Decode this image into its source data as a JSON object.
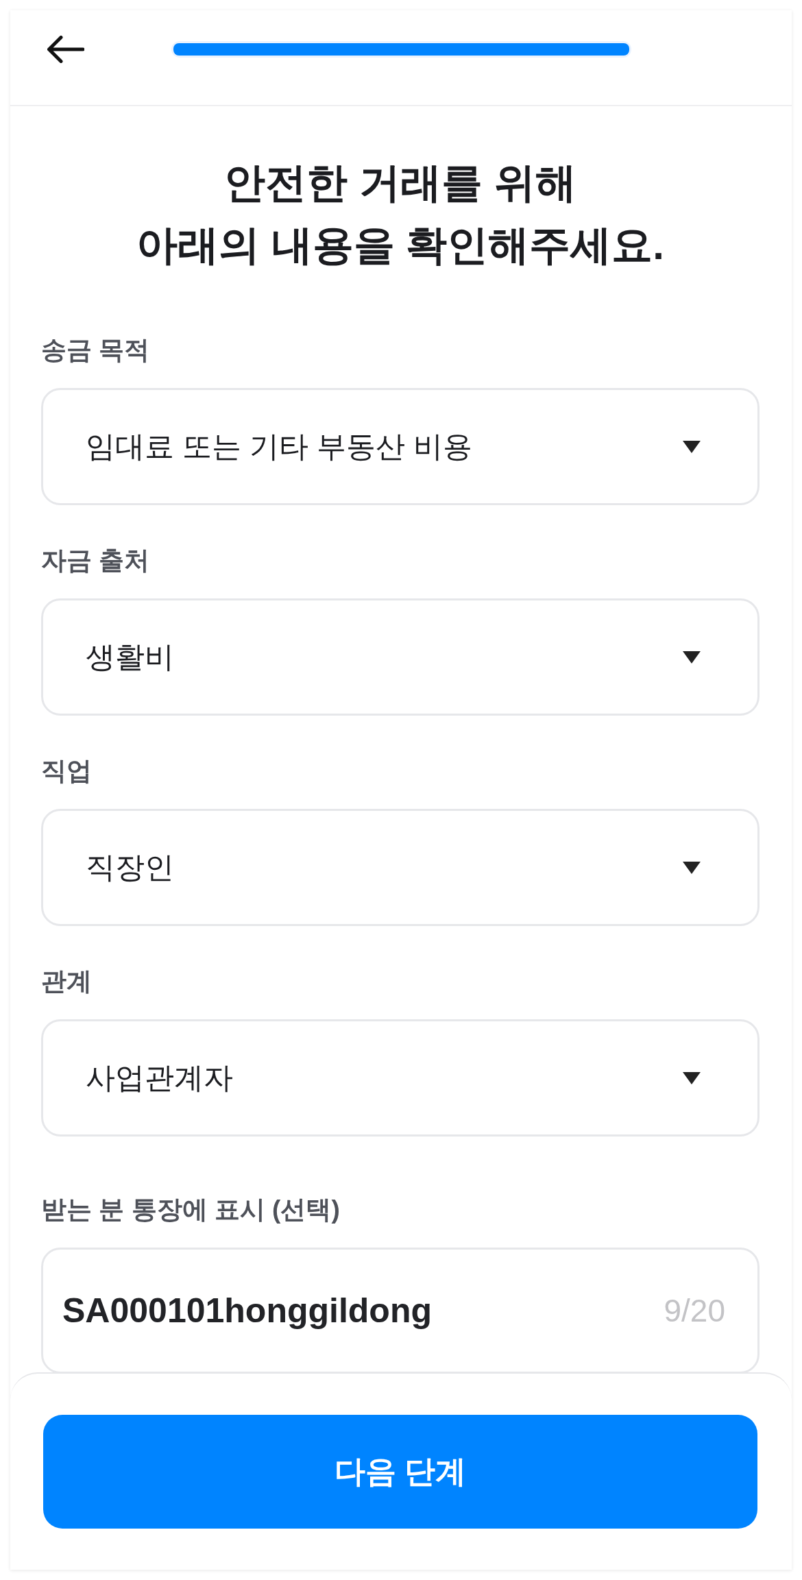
{
  "header": {
    "progress": {
      "level": 1
    }
  },
  "title": "안전한 거래를 위해\n아래의 내용을 확인해주세요.",
  "fields": [
    {
      "kind": "select",
      "label": "송금 목적",
      "value": "임대료 또는 기타 부동산 비용"
    },
    {
      "kind": "select",
      "label": "자금 출처",
      "value": "생활비"
    },
    {
      "kind": "select",
      "label": "직업",
      "value": "직장인"
    },
    {
      "kind": "select",
      "label": "관계",
      "value": "사업관계자"
    },
    {
      "kind": "text",
      "label": "받는 분 통장에 표시 (선택)",
      "value": "SA000101honggildong",
      "counter": "9/20"
    }
  ],
  "footer": {
    "button": "다음 단계"
  }
}
